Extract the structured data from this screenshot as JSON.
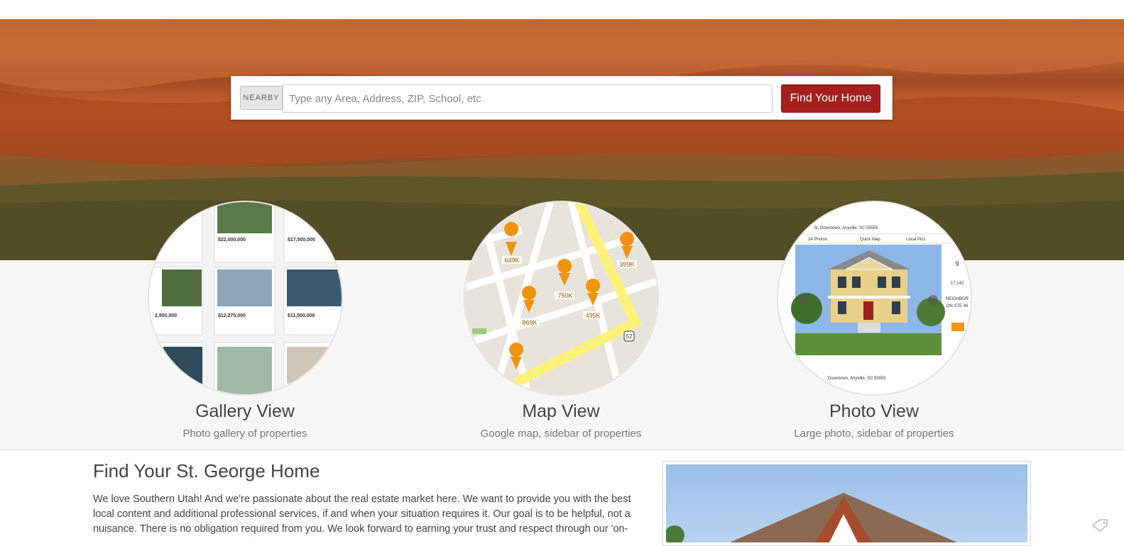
{
  "search": {
    "nearby_label": "NEARBY",
    "placeholder": "Type any Area, Address, ZIP, School, etc",
    "button_label": "Find Your Home"
  },
  "views": [
    {
      "title": "Gallery View",
      "subtitle": "Photo gallery of properties"
    },
    {
      "title": "Map View",
      "subtitle": "Google map, sidebar of properties"
    },
    {
      "title": "Photo View",
      "subtitle": "Large photo, sidebar of properties"
    }
  ],
  "gallery_thumb": {
    "prices": [
      "$22,000,000",
      "$17,500,000",
      "2,950,000",
      "$12,275,000",
      "$11,500,000"
    ]
  },
  "map_thumb": {
    "markers": [
      "649K",
      "399K",
      "750K",
      "495K",
      "869K"
    ],
    "route_shield": "52"
  },
  "photo_thumb": {
    "address_top": "St, Downtown, Anyville, SC 55555",
    "tabs": [
      "24 Photos",
      "Quick Map",
      "Local Pics"
    ],
    "side_values": [
      "9",
      "17,142",
      "NEIGHBOR",
      "ON STE 46"
    ],
    "address_bottom": "Downtown, Anyville, SC 55555"
  },
  "intro": {
    "heading": "Find Your St. George Home",
    "body": "We love Southern Utah! And we're passionate about the real estate market here. We want to provide you with the best local content and additional professional services, if and when your situation requires it. Our goal is to be helpful, not a nuisance. There is no obligation required from you. We look forward to earning your trust and respect through our 'on-"
  },
  "colors": {
    "accent": "#a61f1f",
    "marker": "#f0930f",
    "route": "#fff27a"
  }
}
